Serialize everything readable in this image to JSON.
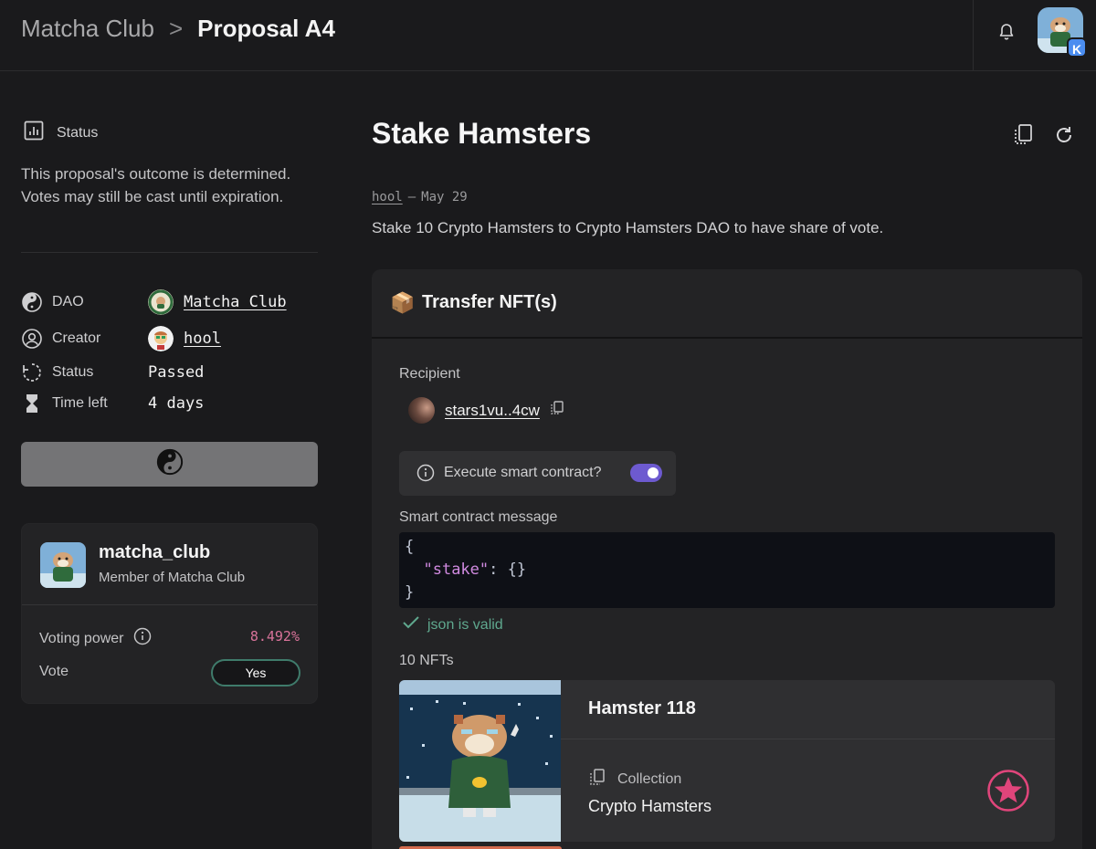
{
  "header": {
    "dao_name": "Matcha Club",
    "separator": ">",
    "proposal_id": "Proposal A4",
    "avatar_badge": "K"
  },
  "status": {
    "label": "Status",
    "description": "This proposal's outcome is determined. Votes may still be cast until expiration."
  },
  "info": {
    "dao": {
      "label": "DAO",
      "value": "Matcha Club"
    },
    "creator": {
      "label": "Creator",
      "value": "hool"
    },
    "status": {
      "label": "Status",
      "value": "Passed"
    },
    "time_left": {
      "label": "Time left",
      "value": "4 days"
    }
  },
  "member": {
    "name": "matcha_club",
    "role": "Member of Matcha Club",
    "voting_power_label": "Voting power",
    "voting_power_value": "8.492%",
    "vote_label": "Vote",
    "vote_value": "Yes"
  },
  "proposal": {
    "title": "Stake Hamsters",
    "author": "hool",
    "date_sep": "–",
    "date": "May 29",
    "description": "Stake 10 Crypto Hamsters to Crypto Hamsters DAO to have share of vote."
  },
  "action": {
    "emoji": "📦",
    "title": "Transfer NFT(s)",
    "recipient_label": "Recipient",
    "recipient_address": "stars1vu..4cw",
    "execute_label": "Execute smart contract?",
    "execute_enabled": true,
    "message_label": "Smart contract message",
    "code_line1": "{",
    "code_key": "\"stake\"",
    "code_rest": ": {}",
    "code_line3": "}",
    "valid_text": "json is valid",
    "nfts_count_label": "10 NFTs"
  },
  "nft": {
    "name": "Hamster 118",
    "collection_label": "Collection",
    "collection_name": "Crypto Hamsters"
  },
  "colors": {
    "accent_purple": "#6d5ad0",
    "valid_green": "#5fa88e",
    "voting_power_pink": "#d9739a",
    "star_pink": "#e0457b"
  },
  "icons": [
    "bell-icon",
    "chart-icon",
    "yin-yang-icon",
    "user-circle-icon",
    "refresh-icon",
    "hourglass-icon",
    "info-icon",
    "copy-icon",
    "check-icon",
    "star-logo-icon",
    "collection-icon"
  ]
}
